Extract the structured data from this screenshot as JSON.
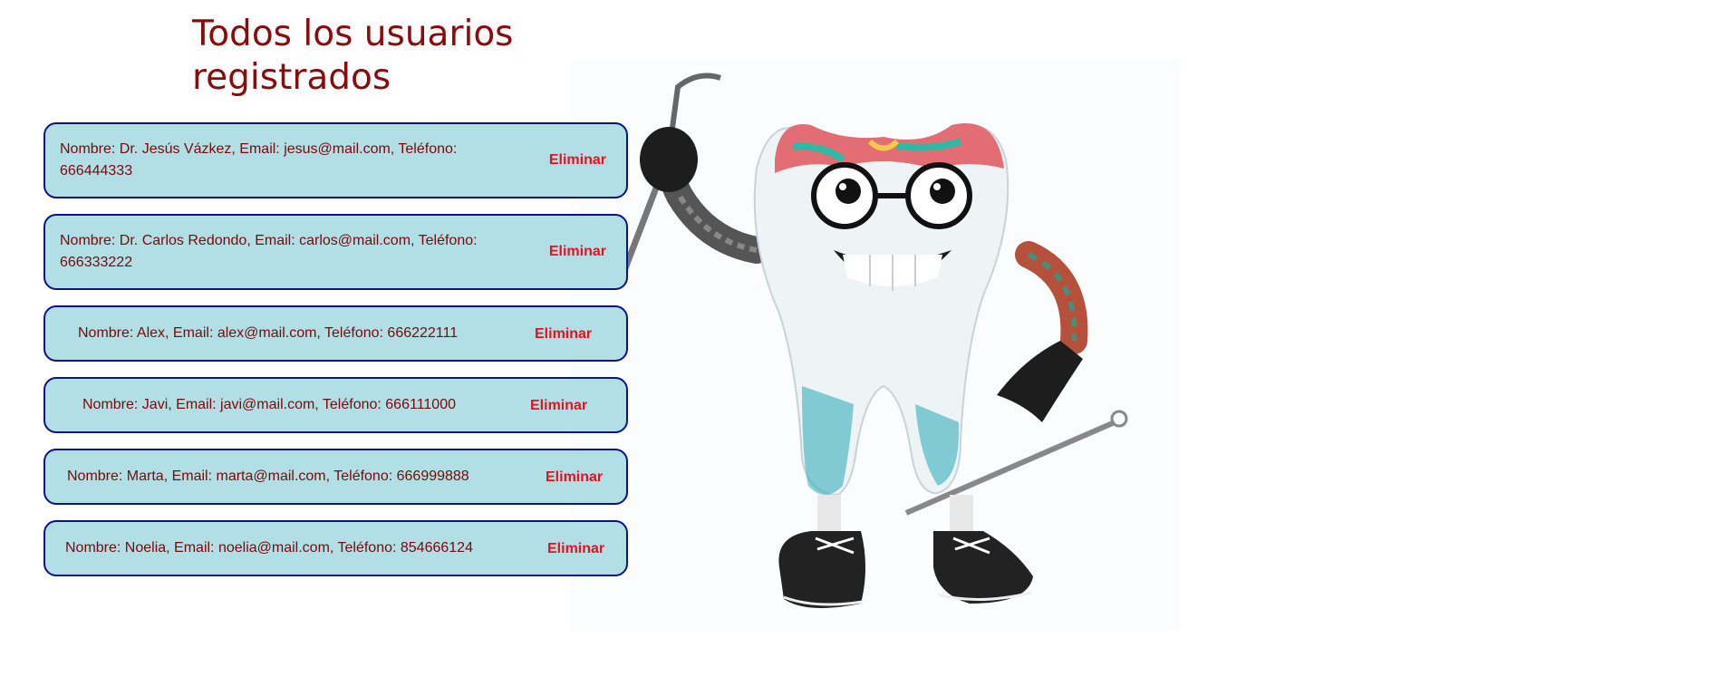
{
  "page": {
    "title": "Todos los usuarios registrados"
  },
  "users": [
    {
      "info": "Nombre: Dr. Jesús Vázkez, Email: jesus@mail.com, Teléfono: 666444333",
      "delete_label": "Eliminar"
    },
    {
      "info": "Nombre: Dr. Carlos Redondo, Email: carlos@mail.com, Teléfono: 666333222",
      "delete_label": "Eliminar"
    },
    {
      "info": "Nombre: Alex, Email: alex@mail.com, Teléfono: 666222111",
      "delete_label": "Eliminar"
    },
    {
      "info": "Nombre: Javi, Email: javi@mail.com, Teléfono: 666111000",
      "delete_label": "Eliminar"
    },
    {
      "info": "Nombre: Marta, Email: marta@mail.com, Teléfono: 666999888",
      "delete_label": "Eliminar"
    },
    {
      "info": "Nombre: Noelia, Email: noelia@mail.com, Teléfono: 854666124",
      "delete_label": "Eliminar"
    }
  ],
  "colors": {
    "title": "#8b0a0a",
    "card_background": "#b2dfe6",
    "card_border": "#0c128c",
    "card_text": "#7a0909",
    "delete_text": "#e8101d"
  },
  "icons": {
    "mascot": "cartoon-tooth-dentist-illustration"
  }
}
